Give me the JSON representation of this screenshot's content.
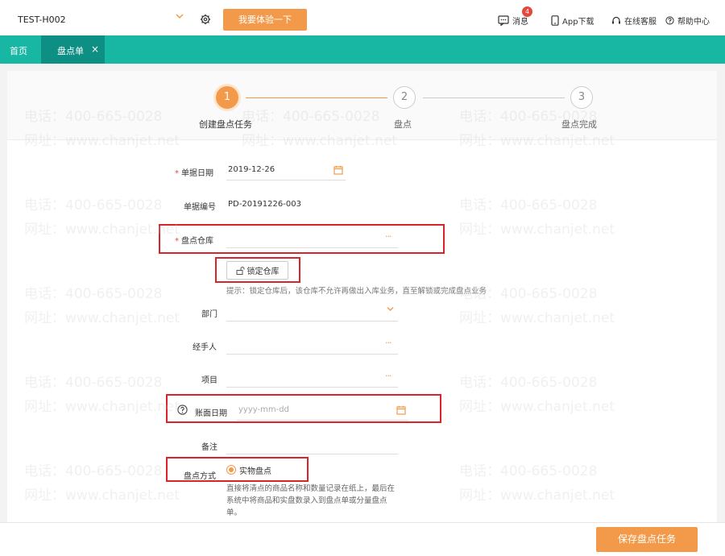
{
  "header": {
    "company": "TEST-H002",
    "trial_label": "我要体验一下",
    "messages_label": "消息",
    "messages_count": "4",
    "app_label": "App下载",
    "service_label": "在线客服",
    "help_label": "帮助中心"
  },
  "nav": {
    "home_label": "首页",
    "active_tab_label": "盘点单",
    "close_glyph": "×"
  },
  "steps": [
    {
      "num": "1",
      "label": "创建盘点任务",
      "active": true
    },
    {
      "num": "2",
      "label": "盘点",
      "active": false
    },
    {
      "num": "3",
      "label": "盘点完成",
      "active": false
    }
  ],
  "form": {
    "doc_date": {
      "label": "单据日期",
      "required_mark": "*",
      "value": "2019-12-26"
    },
    "doc_no": {
      "label": "单据编号",
      "value": "PD-20191226-003"
    },
    "warehouse": {
      "label": "盘点仓库",
      "required_mark": "*",
      "value": "",
      "picker_glyph": "···"
    },
    "lock_button_label": "锁定仓库",
    "tip": "提示：锁定仓库后，该仓库不允许再做出入库业务，直至解锁或完成盘点业务",
    "department": {
      "label": "部门",
      "value": ""
    },
    "handler": {
      "label": "经手人",
      "value": "",
      "picker_glyph": "···"
    },
    "project": {
      "label": "项目",
      "value": "",
      "picker_glyph": "···"
    },
    "book_date": {
      "label": "账面日期",
      "placeholder": "yyyy-mm-dd"
    },
    "remark": {
      "label": "备注",
      "value": ""
    },
    "method": {
      "label": "盘点方式",
      "selected_option": "实物盘点",
      "description": "直接将清点的商品名称和数量记录在纸上，最后在系统中将商品和实盘数录入到盘点单或分量盘点单。"
    }
  },
  "footer": {
    "save_label": "保存盘点任务"
  },
  "watermark": {
    "phone": "电话：400-665-0028",
    "site": "网址：www.chanjet.net"
  },
  "colors": {
    "accent": "#f39a4a",
    "nav": "#17b7a4",
    "nav_active": "#0e8f83",
    "highlight": "#d8242a"
  }
}
